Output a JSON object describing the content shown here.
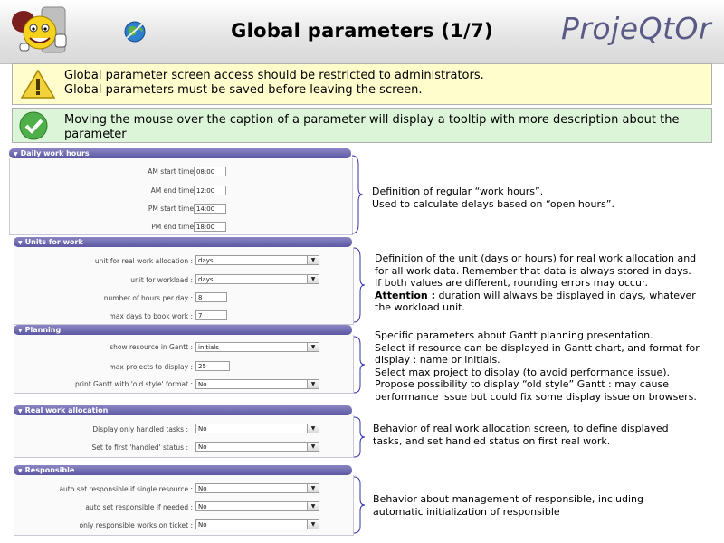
{
  "header": {
    "title": "Global parameters (1/7)",
    "brand": "ProjeQtOr"
  },
  "messages": {
    "warning_line1": "Global parameter screen access should be restricted to administrators.",
    "warning_line2": "Global parameters must be saved before leaving the screen.",
    "info": "Moving the mouse over the caption of a parameter will display a tooltip with more description about the parameter"
  },
  "sections": {
    "daily": {
      "title": "Daily work hours",
      "am_start_label": "AM start time :",
      "am_start_value": "08:00",
      "am_end_label": "AM end time :",
      "am_end_value": "12:00",
      "pm_start_label": "PM start time :",
      "pm_start_value": "14:00",
      "pm_end_label": "PM end time :",
      "pm_end_value": "18:00"
    },
    "units": {
      "title": "Units for work",
      "real_label": "unit for real work allocation :",
      "real_value": "days",
      "workload_label": "unit for workload :",
      "workload_value": "days",
      "hours_label": "number of hours per day :",
      "hours_value": "8",
      "maxdays_label": "max days to book work :",
      "maxdays_value": "7"
    },
    "planning": {
      "title": "Planning",
      "show_res_label": "show resource in Gantt :",
      "show_res_value": "initials",
      "max_proj_label": "max projects to display :",
      "max_proj_value": "25",
      "old_style_label": "print Gantt with 'old style' format :",
      "old_style_value": "No"
    },
    "real_work": {
      "title": "Real work allocation",
      "handled_label": "Display only handled tasks :",
      "handled_value": "No",
      "first_label": "Set to first 'handled' status :",
      "first_value": "No"
    },
    "responsible": {
      "title": "Responsible",
      "single_label": "auto set responsible if single resource :",
      "single_value": "No",
      "needed_label": "auto set responsible if needed :",
      "needed_value": "No",
      "only_label": "only responsible works on ticket :",
      "only_value": "No"
    }
  },
  "notes": {
    "daily_1": "Definition of regular “work hours”.",
    "daily_2": "Used to calculate delays based on “open hours”.",
    "units_1": "Definition of the unit (days or hours) for real work allocation and",
    "units_2": "for all work data. Remember that data is always stored in days.",
    "units_3": "If both values are different, rounding errors may occur.",
    "units_4_bold": "Attention :",
    "units_4": " duration will always be displayed in days, whatever",
    "units_5": "the workload unit.",
    "planning_1": "Specific parameters about Gantt planning presentation.",
    "planning_2": "Select if resource can be displayed in Gantt chart, and format for",
    "planning_3": "display : name or initials.",
    "planning_4": "Select max project to display (to avoid performance issue).",
    "planning_5": "Propose possibility to display “old style” Gantt : may cause",
    "planning_6": "performance issue but could fix some display issue on browsers.",
    "real_1": "Behavior of real work allocation screen, to define displayed",
    "real_2": "tasks, and set handled status on first real work.",
    "resp_1": "Behavior about management of responsible, including",
    "resp_2": "automatic initialization of responsible"
  },
  "icons": {
    "logo": "projeqtor-mascot-logo",
    "globe": "globe-icon",
    "warning": "warning-icon",
    "ok": "check-icon"
  },
  "colors": {
    "section_header": "#5c58a2",
    "brand": "#5a5a86",
    "warning_bg": "#fffdcc",
    "info_bg": "#dcf5d8"
  }
}
